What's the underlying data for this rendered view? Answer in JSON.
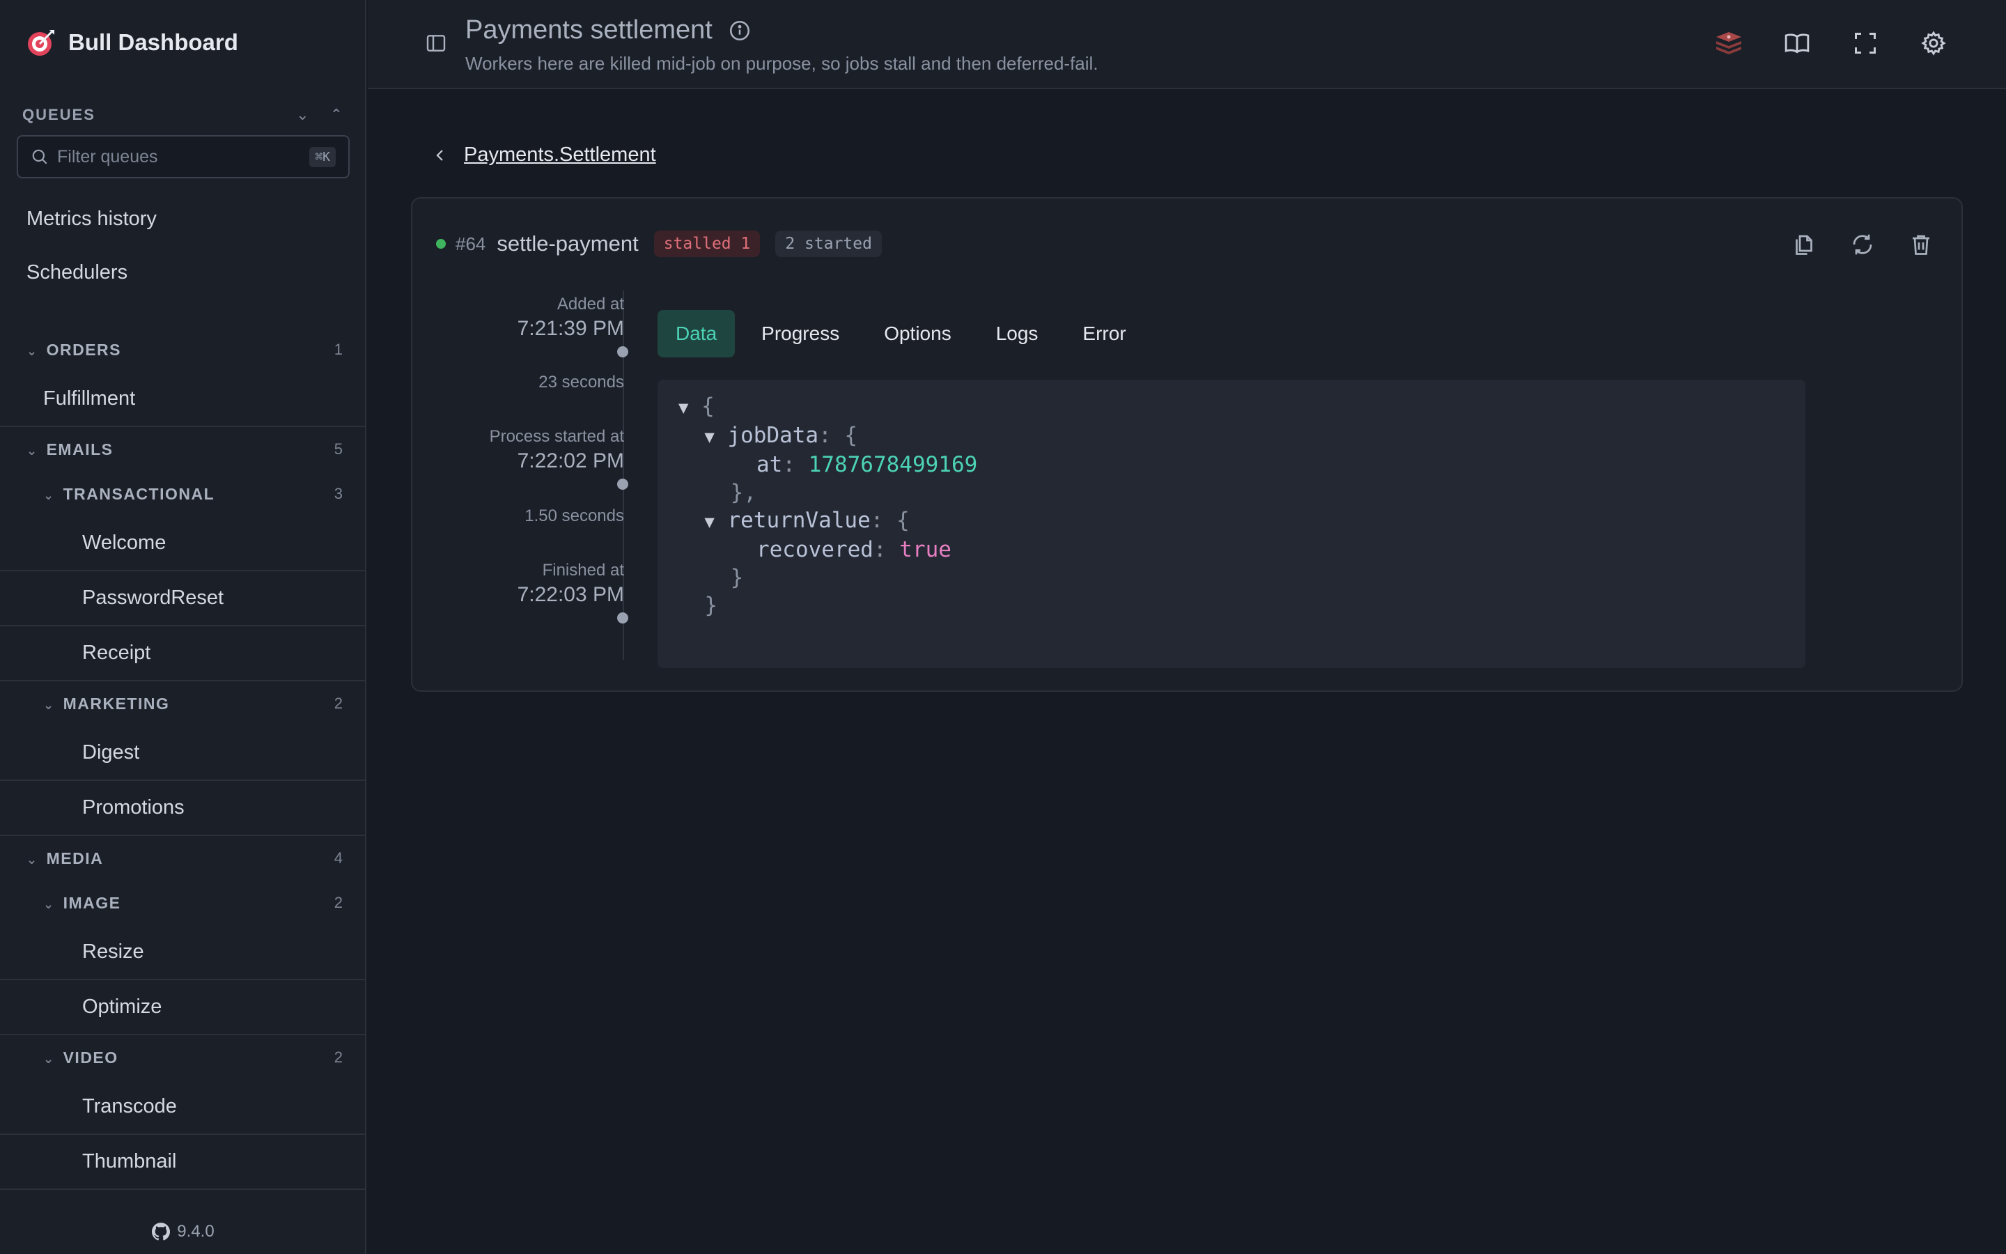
{
  "app": {
    "title": "Bull Dashboard",
    "version": "9.4.0"
  },
  "sidebar": {
    "queues_title": "QUEUES",
    "filter": {
      "placeholder": "Filter queues",
      "shortcut": "⌘K"
    },
    "links": [
      "Metrics history",
      "Schedulers"
    ],
    "tree": [
      {
        "type": "group",
        "label": "ORDERS",
        "count": "1",
        "level": 0
      },
      {
        "type": "leaf",
        "label": "Fulfillment",
        "level": 1
      },
      {
        "type": "group",
        "label": "EMAILS",
        "count": "5",
        "level": 0
      },
      {
        "type": "group",
        "label": "TRANSACTIONAL",
        "count": "3",
        "level": 1
      },
      {
        "type": "leaf",
        "label": "Welcome",
        "level": 2
      },
      {
        "type": "leaf",
        "label": "PasswordReset",
        "level": 2
      },
      {
        "type": "leaf",
        "label": "Receipt",
        "level": 2
      },
      {
        "type": "group",
        "label": "MARKETING",
        "count": "2",
        "level": 1
      },
      {
        "type": "leaf",
        "label": "Digest",
        "level": 2
      },
      {
        "type": "leaf",
        "label": "Promotions",
        "level": 2
      },
      {
        "type": "group",
        "label": "MEDIA",
        "count": "4",
        "level": 0
      },
      {
        "type": "group",
        "label": "IMAGE",
        "count": "2",
        "level": 1
      },
      {
        "type": "leaf",
        "label": "Resize",
        "level": 2
      },
      {
        "type": "leaf",
        "label": "Optimize",
        "level": 2
      },
      {
        "type": "group",
        "label": "VIDEO",
        "count": "2",
        "level": 1
      },
      {
        "type": "leaf",
        "label": "Transcode",
        "level": 2
      },
      {
        "type": "leaf",
        "label": "Thumbnail",
        "level": 2
      }
    ]
  },
  "header": {
    "title": "Payments settlement",
    "subtitle": "Workers here are killed mid-job on purpose, so jobs stall and then deferred-fail."
  },
  "breadcrumb": {
    "back_label": "Payments.Settlement"
  },
  "job": {
    "id": "#64",
    "name": "settle-payment",
    "badge_stalled": "stalled 1",
    "badge_started": "2 started",
    "status_color": "#3fb45e",
    "timeline": {
      "added_label": "Added at",
      "added_time": "7:21:39 PM",
      "wait_duration": "23 seconds",
      "started_label": "Process started at",
      "started_time": "7:22:02 PM",
      "run_duration": "1.50 seconds",
      "finished_label": "Finished at",
      "finished_time": "7:22:03 PM"
    },
    "tabs": [
      "Data",
      "Progress",
      "Options",
      "Logs",
      "Error"
    ],
    "active_tab": "Data",
    "data": {
      "jobData_key": "jobData",
      "at_key": "at",
      "at_value": "1787678499169",
      "returnValue_key": "returnValue",
      "recovered_key": "recovered",
      "recovered_value": "true"
    }
  }
}
